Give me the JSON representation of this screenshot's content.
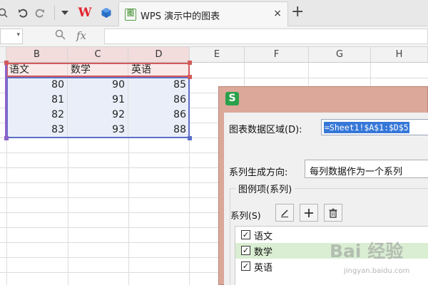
{
  "titlebar": {
    "doc_title": "WPS 演示中的图表",
    "wps_logo": "W",
    "new_tab": "+",
    "close": "×",
    "icons": [
      "undo-icon",
      "redo-icon",
      "dropdown-icon",
      "wps-logo",
      "cube-icon",
      "document-icon"
    ]
  },
  "formula_bar": {
    "fx": "fx",
    "zoom_icon": "magnifier-icon",
    "value": ""
  },
  "grid": {
    "columns": [
      "B",
      "C",
      "D",
      "E",
      "F",
      "G",
      "H"
    ],
    "header_row": [
      "语文",
      "数学",
      "英语"
    ],
    "rows": [
      [
        "80",
        "90",
        "85"
      ],
      [
        "81",
        "91",
        "86"
      ],
      [
        "82",
        "92",
        "86"
      ],
      [
        "83",
        "93",
        "88"
      ]
    ]
  },
  "dialog": {
    "icon_letter": "S",
    "range_label": "图表数据区域(D):",
    "range_value": "=Sheet1!$A$1:$D$5",
    "direction_label": "系列生成方向:",
    "direction_value": "每列数据作为一个系列",
    "legend_group_title": "图例项(系列)",
    "series_label": "系列(S)",
    "series_items": [
      {
        "label": "语文",
        "checked": true,
        "highlighted": false
      },
      {
        "label": "数学",
        "checked": true,
        "highlighted": true
      },
      {
        "label": "英语",
        "checked": true,
        "highlighted": false
      }
    ],
    "buttons": [
      "edit-icon",
      "add-icon",
      "delete-icon"
    ]
  },
  "watermark": {
    "main": "Bai 经验",
    "sub": "jingyan.baidu.com"
  },
  "colors": {
    "accent_blue": "#3677d8",
    "dialog_frame": "#dca89a",
    "wps_red": "#e3242b",
    "sheet_green": "#2aa14a"
  }
}
